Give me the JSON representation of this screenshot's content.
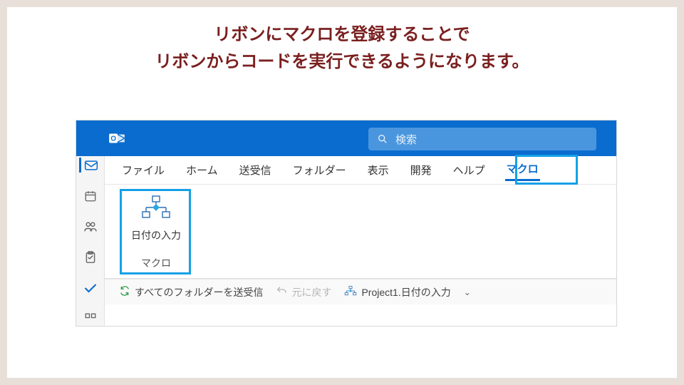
{
  "caption": {
    "line1": "リボンにマクロを登録することで",
    "line2": "リボンからコードを実行できるようになります。"
  },
  "titlebar": {
    "app_icon": "outlook-logo"
  },
  "search": {
    "placeholder": "検索"
  },
  "nav_rail": {
    "items": [
      "mail",
      "calendar",
      "people",
      "tasks",
      "todo",
      "more"
    ]
  },
  "tabs": {
    "file": "ファイル",
    "home": "ホーム",
    "sendreceive": "送受信",
    "folder": "フォルダー",
    "view": "表示",
    "developer": "開発",
    "help": "ヘルプ",
    "macro": "マクロ"
  },
  "ribbon": {
    "macro_group": {
      "button_label": "日付の入力",
      "group_label": "マクロ"
    }
  },
  "qat": {
    "sendall": "すべてのフォルダーを送受信",
    "undo": "元に戻す",
    "project_macro": "Project1.日付の入力"
  }
}
